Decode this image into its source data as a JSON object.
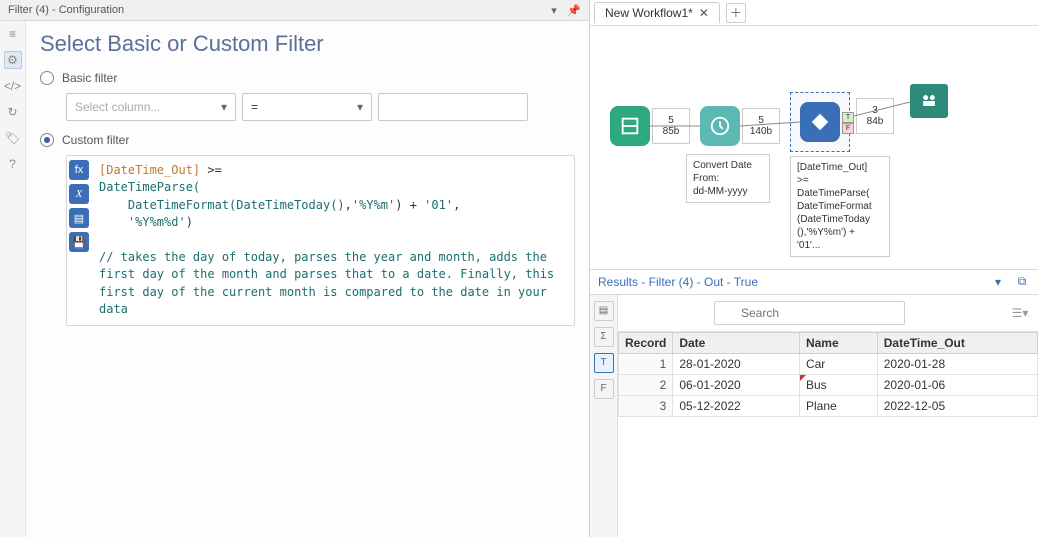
{
  "panel": {
    "title": "Filter (4) - Configuration",
    "heading": "Select Basic or Custom Filter",
    "basic_label": "Basic filter",
    "custom_label": "Custom filter",
    "column_placeholder": "Select column...",
    "operator_value": "="
  },
  "expr": {
    "field": "[DateTime_Out]",
    "op": ">=",
    "fn1": "DateTimeParse(",
    "fn2": "DateTimeFormat(",
    "fn3": "DateTimeToday()",
    "fmt1": "'%Y%m'",
    "close1": ")",
    "plus": " + ",
    "lit01": "'01'",
    "comma": ",",
    "fmt2": "'%Y%m%d'",
    "close2": ")",
    "comment": "// takes the day of today, parses the year and month, adds the\nfirst day of the month and parses that to a date. Finally, this\nfirst day of the current month is compared to the date in your\ndata"
  },
  "tab": {
    "name": "New Workflow1*"
  },
  "canvas": {
    "badge1_n": "5",
    "badge1_b": "85b",
    "badge2_n": "5",
    "badge2_b": "140b",
    "badge3_n": "3",
    "badge3_b": "84b",
    "label1": "Convert Date\nFrom:\ndd-MM-yyyy",
    "label2": "[DateTime_Out]\n>=\nDateTimeParse(\nDateTimeFormat\n(DateTimeToday\n(),'%Y%m') +\n'01'..."
  },
  "results": {
    "title": "Results - Filter (4) - Out - True",
    "search_placeholder": "Search",
    "columns": [
      "Record",
      "Date",
      "Name",
      "DateTime_Out"
    ],
    "rows": [
      {
        "rec": "1",
        "date": "28-01-2020",
        "name": "Car",
        "dt": "2020-01-28"
      },
      {
        "rec": "2",
        "date": "06-01-2020",
        "name": "Bus",
        "dt": "2020-01-06"
      },
      {
        "rec": "3",
        "date": "05-12-2022",
        "name": "Plane",
        "dt": "2022-12-05"
      }
    ]
  }
}
